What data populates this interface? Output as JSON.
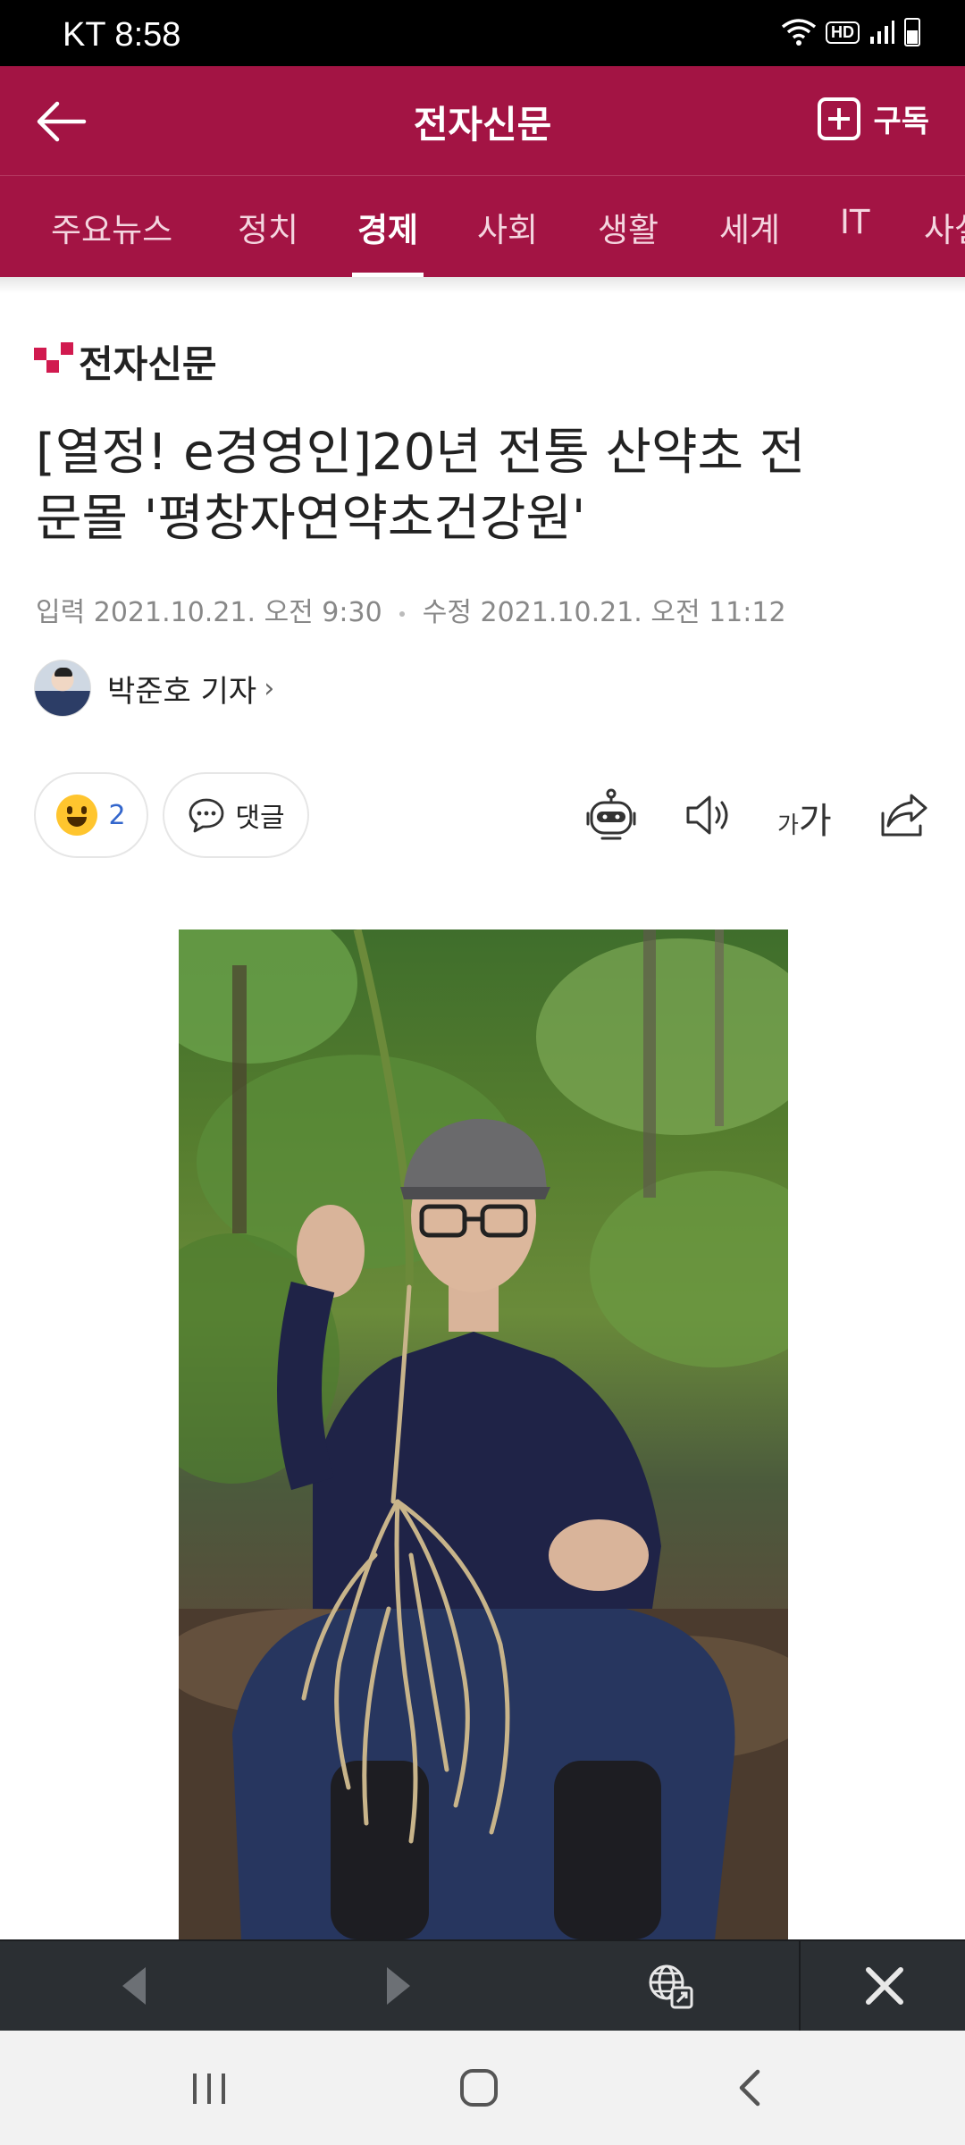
{
  "status_bar": {
    "carrier_time": "KT 8:58",
    "hd_label": "HD"
  },
  "header": {
    "title": "전자신문",
    "subscribe_label": "구독"
  },
  "tabs": [
    {
      "label": "주요뉴스"
    },
    {
      "label": "정치"
    },
    {
      "label": "경제",
      "active": true
    },
    {
      "label": "사회"
    },
    {
      "label": "생활"
    },
    {
      "label": "세계"
    },
    {
      "label": "IT"
    },
    {
      "label": "사설"
    }
  ],
  "article": {
    "publisher_logo": "전자신문",
    "headline_line1": "[열정! e경영인]20년 전통 산약초 전",
    "headline_line2": "문몰 '평창자연약초건강원'",
    "published": "입력 2021.10.21. 오전 9:30",
    "modified": "수정 2021.10.21. 오전 11:12",
    "reporter": "박준호 기자"
  },
  "actions": {
    "reaction_count": "2",
    "comment_label": "댓글",
    "font_small": "가",
    "font_big": "가"
  },
  "colors": {
    "brand": "#a31444",
    "accent": "#d11a4f",
    "link": "#3366cc"
  }
}
